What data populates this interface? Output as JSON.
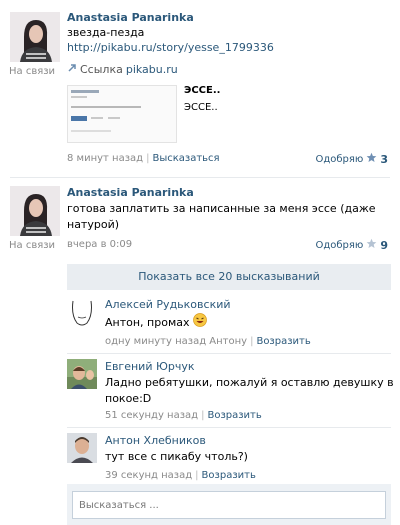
{
  "post1": {
    "author": "Anastasia Panarinka",
    "online": "На связи",
    "text": "звезда-пезда",
    "url": "http://pikabu.ru/story/yesse_1799336",
    "attach_label_prefix": "Ссылка",
    "attach_label_domain": "pikabu.ru",
    "attach_title": "ЭССЕ..",
    "attach_desc": "ЭССЕ..",
    "time": "8 минут назад",
    "comment": "Высказаться",
    "like_label": "Одобряю",
    "like_count": "3"
  },
  "post2": {
    "author": "Anastasia Panarinka",
    "online": "На связи",
    "text_line1": "готова заплатить за написанные за меня эссе (даже",
    "text_line2": "натурой)",
    "time": "вчера в 0:09",
    "like_label": "Одобряю",
    "like_count": "9"
  },
  "replies": {
    "show_all": "Показать все 20 высказываний",
    "items": [
      {
        "author": "Алексей Рудьковский",
        "text": "Антон, промах",
        "time": "одну минуту назад Антону",
        "action": "Возразить"
      },
      {
        "author": "Евгений Юрчук",
        "text_line1": "Ладно ребятушки, пожалуй я оставлю девушку в",
        "text_line2": "покое:D",
        "time": "51 секунду назад",
        "action": "Возразить"
      },
      {
        "author": "Антон Хлебников",
        "text": "тут все с пикабу чтоль?)",
        "time": "39 секунд назад",
        "action": "Возразить"
      }
    ],
    "input_placeholder": "Высказаться ..."
  }
}
